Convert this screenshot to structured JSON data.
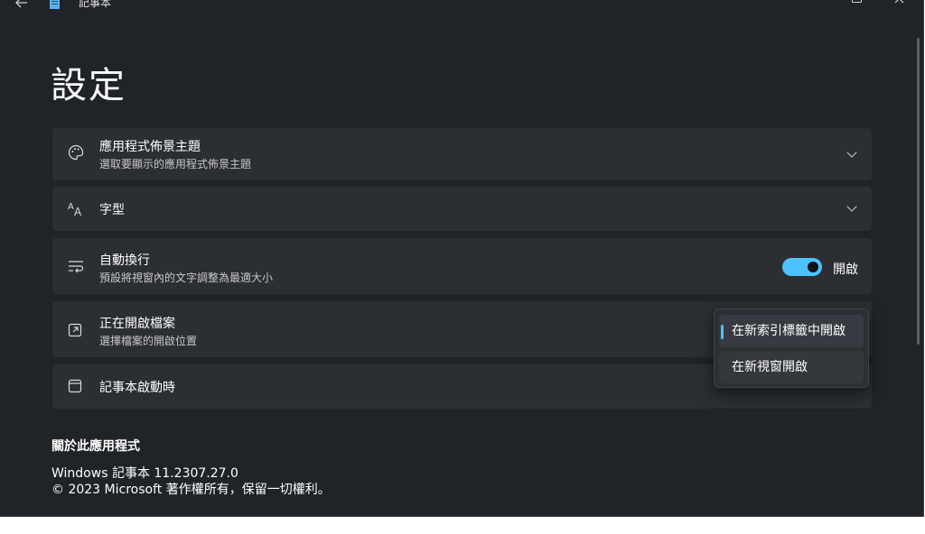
{
  "window": {
    "title": "記事本"
  },
  "page": {
    "title": "設定"
  },
  "cards": {
    "theme": {
      "title": "應用程式佈景主題",
      "subtitle": "選取要顯示的應用程式佈景主題"
    },
    "font": {
      "title": "字型"
    },
    "wrap": {
      "title": "自動換行",
      "subtitle": "預設將視窗內的文字調整為最適大小",
      "toggle_state": "開啟",
      "toggle_on": true
    },
    "open_files": {
      "title": "正在開啟檔案",
      "subtitle": "選擇檔案的開啟位置"
    },
    "startup": {
      "title": "記事本啟動時"
    }
  },
  "dropdown": {
    "options": [
      "在新索引標籤中開啟",
      "在新視窗開啟"
    ],
    "selected": "在新索引標籤中開啟"
  },
  "about": {
    "heading": "關於此應用程式",
    "version": "Windows 記事本 11.2307.27.0",
    "copyright": "© 2023 Microsoft 著作權所有，保留一切權利。"
  },
  "colors": {
    "accent": "#4cc2ff",
    "background": "#202328",
    "card": "#2b2e33"
  }
}
